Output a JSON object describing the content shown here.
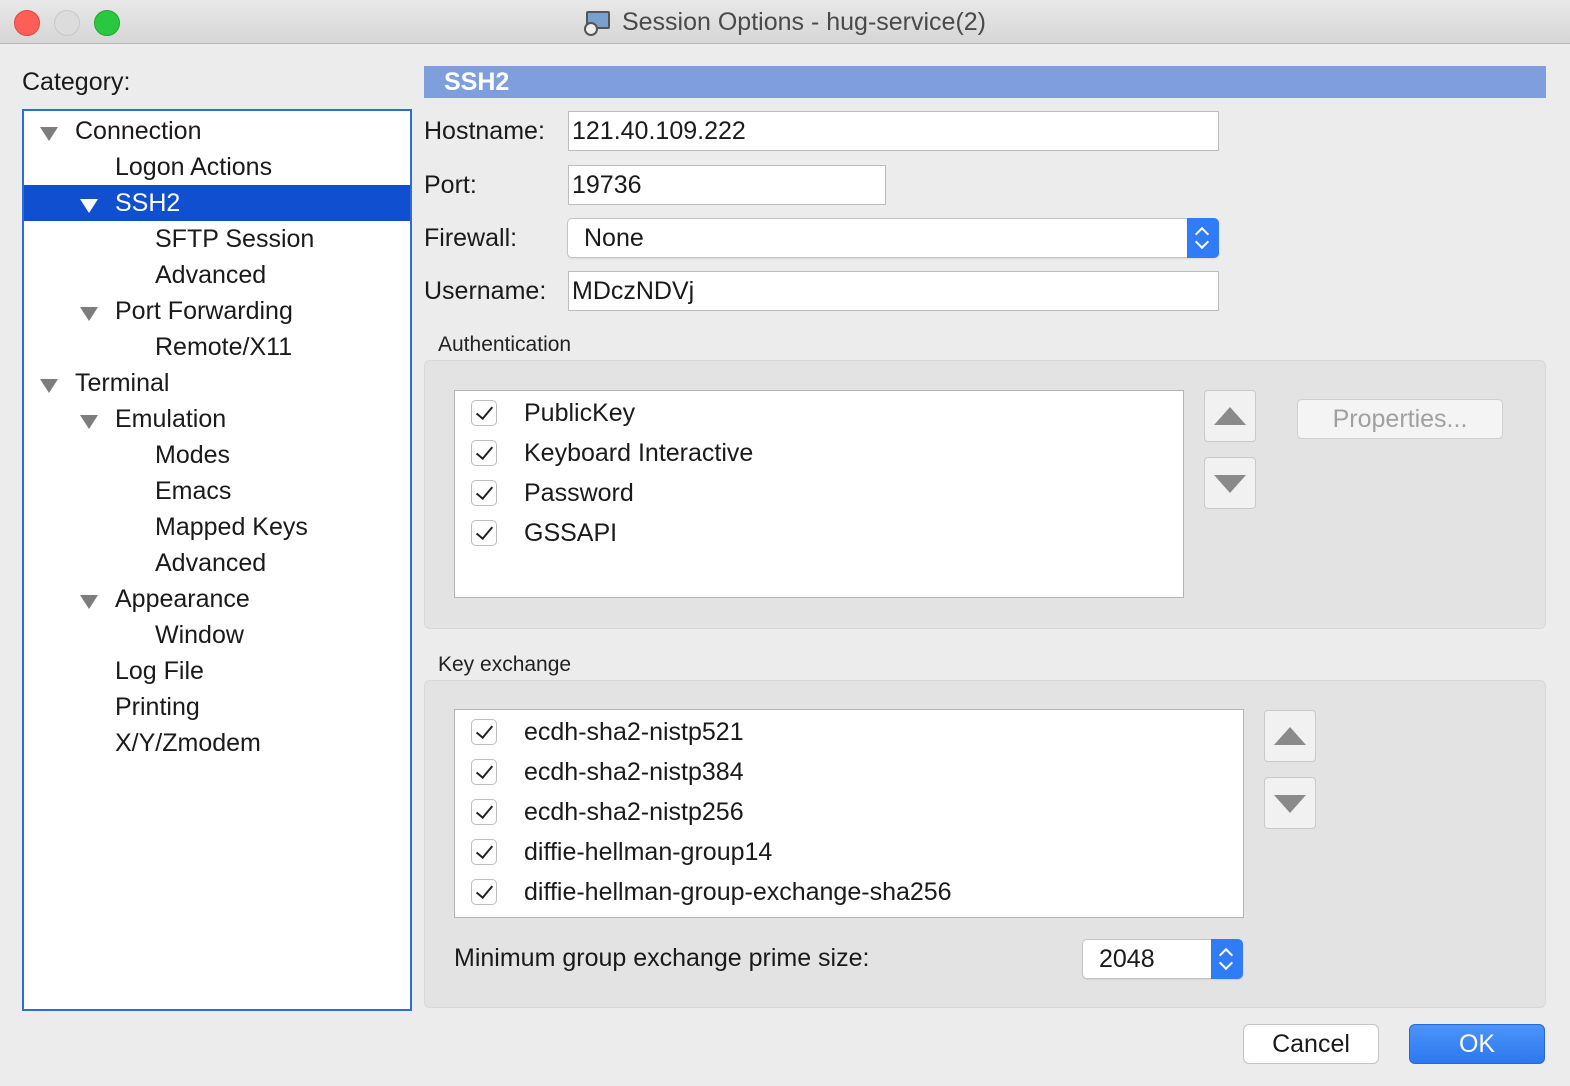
{
  "window": {
    "title": "Session Options - hug-service(2)"
  },
  "category": {
    "label": "Category:",
    "tree": [
      {
        "label": "Connection",
        "expanded": true,
        "selected": false
      },
      {
        "label": "Logon Actions",
        "selected": false
      },
      {
        "label": "SSH2",
        "expanded": true,
        "selected": true
      },
      {
        "label": "SFTP Session",
        "selected": false
      },
      {
        "label": "Advanced",
        "selected": false
      },
      {
        "label": "Port Forwarding",
        "expanded": true,
        "selected": false
      },
      {
        "label": "Remote/X11",
        "selected": false
      },
      {
        "label": "Terminal",
        "expanded": true,
        "selected": false
      },
      {
        "label": "Emulation",
        "expanded": true,
        "selected": false
      },
      {
        "label": "Modes",
        "selected": false
      },
      {
        "label": "Emacs",
        "selected": false
      },
      {
        "label": "Mapped Keys",
        "selected": false
      },
      {
        "label": "Advanced",
        "selected": false
      },
      {
        "label": "Appearance",
        "expanded": true,
        "selected": false
      },
      {
        "label": "Window",
        "selected": false
      },
      {
        "label": "Log File",
        "selected": false
      },
      {
        "label": "Printing",
        "selected": false
      },
      {
        "label": "X/Y/Zmodem",
        "selected": false
      }
    ]
  },
  "panel": {
    "header": "SSH2",
    "hostname": {
      "label": "Hostname:",
      "value": "121.40.109.222"
    },
    "port": {
      "label": "Port:",
      "value": "19736"
    },
    "firewall": {
      "label": "Firewall:",
      "value": "None"
    },
    "username": {
      "label": "Username:",
      "value": "MDczNDVj"
    }
  },
  "authentication": {
    "title": "Authentication",
    "items": [
      {
        "label": "PublicKey",
        "checked": true
      },
      {
        "label": "Keyboard Interactive",
        "checked": true
      },
      {
        "label": "Password",
        "checked": true
      },
      {
        "label": "GSSAPI",
        "checked": true
      }
    ],
    "properties_label": "Properties..."
  },
  "key_exchange": {
    "title": "Key exchange",
    "items": [
      {
        "label": "ecdh-sha2-nistp521",
        "checked": true
      },
      {
        "label": "ecdh-sha2-nistp384",
        "checked": true
      },
      {
        "label": "ecdh-sha2-nistp256",
        "checked": true
      },
      {
        "label": "diffie-hellman-group14",
        "checked": true
      },
      {
        "label": "diffie-hellman-group-exchange-sha256",
        "checked": true
      }
    ],
    "prime_size": {
      "label": "Minimum group exchange prime size:",
      "value": "2048"
    }
  },
  "buttons": {
    "cancel": "Cancel",
    "ok": "OK"
  },
  "colors": {
    "selection": "#1050d0",
    "header_bar": "#7f9ede",
    "accent": "#2f7cf6"
  }
}
